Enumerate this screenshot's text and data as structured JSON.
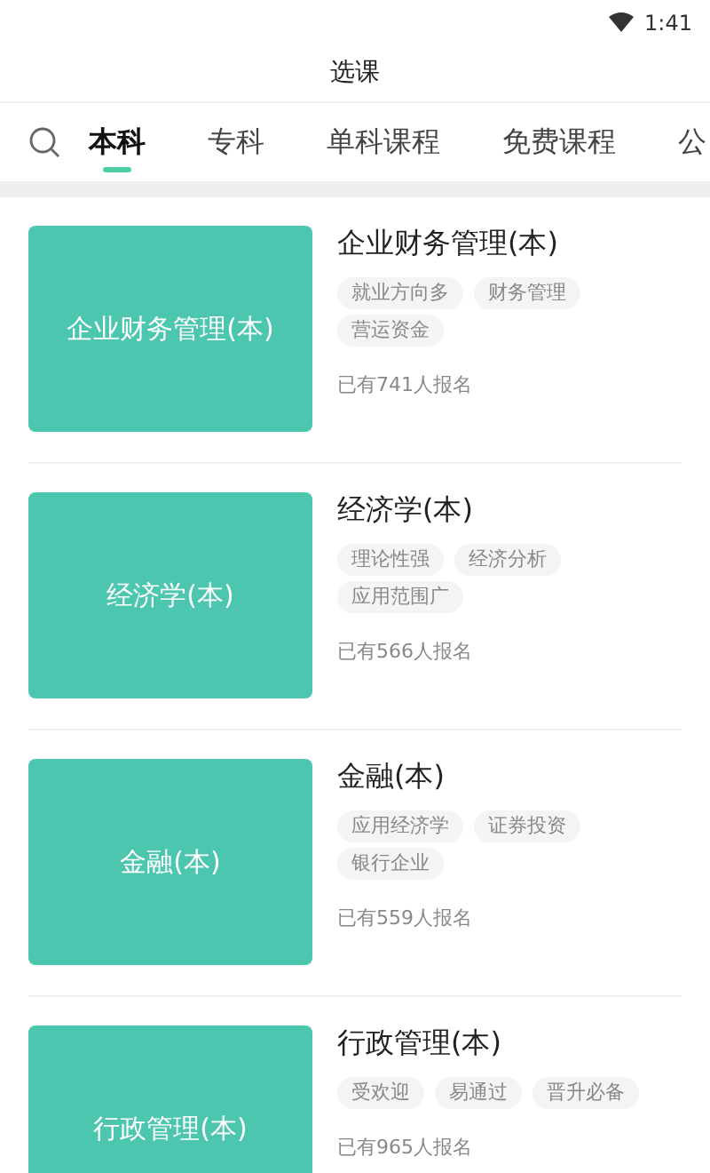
{
  "status_bar": {
    "time": "1:41"
  },
  "header": {
    "title": "选课"
  },
  "tabs": [
    {
      "label": "本科",
      "selected": true
    },
    {
      "label": "专科",
      "selected": false
    },
    {
      "label": "单科课程",
      "selected": false
    },
    {
      "label": "免费课程",
      "selected": false
    },
    {
      "label": "公",
      "selected": false
    }
  ],
  "courses": [
    {
      "thumb_title": "企业财务管理(本)",
      "title": "企业财务管理(本)",
      "tags": [
        "就业方向多",
        "财务管理",
        "营运资金"
      ],
      "enrolled": "已有741人报名"
    },
    {
      "thumb_title": "经济学(本)",
      "title": "经济学(本)",
      "tags": [
        "理论性强",
        "经济分析",
        "应用范围广"
      ],
      "enrolled": "已有566人报名"
    },
    {
      "thumb_title": "金融(本)",
      "title": "金融(本)",
      "tags": [
        "应用经济学",
        "证券投资",
        "银行企业"
      ],
      "enrolled": "已有559人报名"
    },
    {
      "thumb_title": "行政管理(本)",
      "title": "行政管理(本)",
      "tags": [
        "受欢迎",
        "易通过",
        "晋升必备"
      ],
      "enrolled": "已有965人报名"
    }
  ]
}
